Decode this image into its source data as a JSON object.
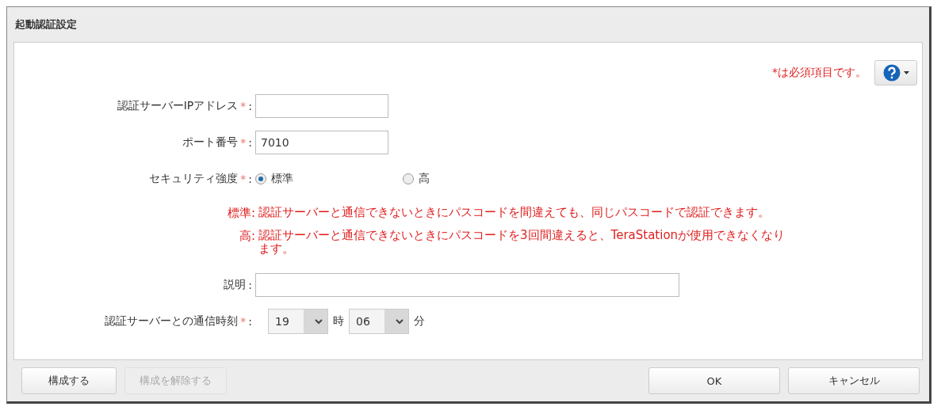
{
  "window": {
    "title": "起動認証設定"
  },
  "required_note": "*は必須項目です。",
  "fields": [
    {
      "kind": "text",
      "label": "認証サーバーIPアドレス",
      "required_mark": "*",
      "separator": ":"
    },
    {
      "kind": "text",
      "label": "ポート番号",
      "required_mark": "*",
      "separator": ":",
      "value": "7010"
    },
    {
      "kind": "radio",
      "label": "セキュリティ強度",
      "required_mark": "*",
      "separator": ":",
      "options": [
        {
          "label": "標準",
          "selected": true
        },
        {
          "label": "高",
          "selected": false
        }
      ]
    },
    {
      "kind": "notes",
      "notes": [
        {
          "term": "標準:",
          "text": "認証サーバーと通信できないときにパスコードを間違えても、同じパスコードで認証できます。"
        },
        {
          "term": "高:",
          "text": "認証サーバーと通信できないときにパスコードを3回間違えると、TeraStationが使用できなくなります。"
        }
      ]
    },
    {
      "kind": "wide-text",
      "label": "説明",
      "separator": ":"
    },
    {
      "kind": "time",
      "label": "認証サーバーとの通信時刻",
      "required_mark": "*",
      "separator": ":",
      "hour": "19",
      "hour_unit": "時",
      "minute": "06",
      "minute_unit": "分"
    }
  ],
  "footer_left": [
    {
      "label": "構成する",
      "disabled": false
    },
    {
      "label": "構成を解除する",
      "disabled": true
    }
  ],
  "footer_right": [
    {
      "label": "OK",
      "disabled": false
    },
    {
      "label": "キャンセル",
      "disabled": false
    }
  ]
}
